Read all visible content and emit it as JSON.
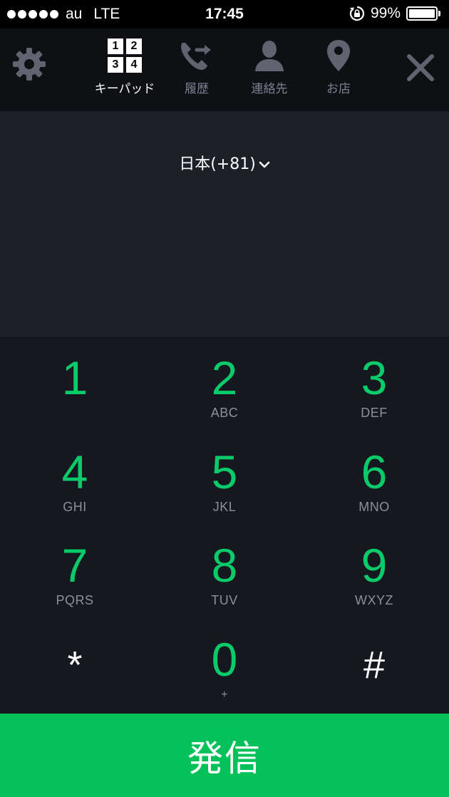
{
  "status_bar": {
    "carrier": "au",
    "network": "LTE",
    "time": "17:45",
    "battery": "99%",
    "battery_level": 0.99,
    "signal_dots": 5,
    "icons": [
      "signal-dots-icon",
      "orientation-lock-icon",
      "battery-icon"
    ]
  },
  "toolbar": {
    "settings_icon": "gear-icon",
    "close_icon": "close-icon",
    "tabs": [
      {
        "label": "キーパッド",
        "icon": "keypad-icon",
        "active": true,
        "digits": [
          "1",
          "2",
          "3",
          "4"
        ]
      },
      {
        "label": "履歴",
        "icon": "call-history-icon",
        "active": false
      },
      {
        "label": "連絡先",
        "icon": "contacts-icon",
        "active": false
      },
      {
        "label": "お店",
        "icon": "location-pin-icon",
        "active": false
      }
    ]
  },
  "display": {
    "country": "日本(+81)",
    "dropdown_icon": "chevron-down-icon",
    "number": ""
  },
  "keypad": {
    "keys": [
      {
        "digit": "1",
        "letters": ""
      },
      {
        "digit": "2",
        "letters": "ABC"
      },
      {
        "digit": "3",
        "letters": "DEF"
      },
      {
        "digit": "4",
        "letters": "GHI"
      },
      {
        "digit": "5",
        "letters": "JKL"
      },
      {
        "digit": "6",
        "letters": "MNO"
      },
      {
        "digit": "7",
        "letters": "PQRS"
      },
      {
        "digit": "8",
        "letters": "TUV"
      },
      {
        "digit": "9",
        "letters": "WXYZ"
      },
      {
        "digit": "*",
        "letters": ""
      },
      {
        "digit": "0",
        "letters": "+"
      },
      {
        "digit": "#",
        "letters": ""
      }
    ]
  },
  "call_button": {
    "label": "発信"
  },
  "colors": {
    "accent_green": "#05c15a",
    "digit_green": "#0acb6a",
    "background": "#16181f",
    "toolbar": "#0f1014"
  }
}
